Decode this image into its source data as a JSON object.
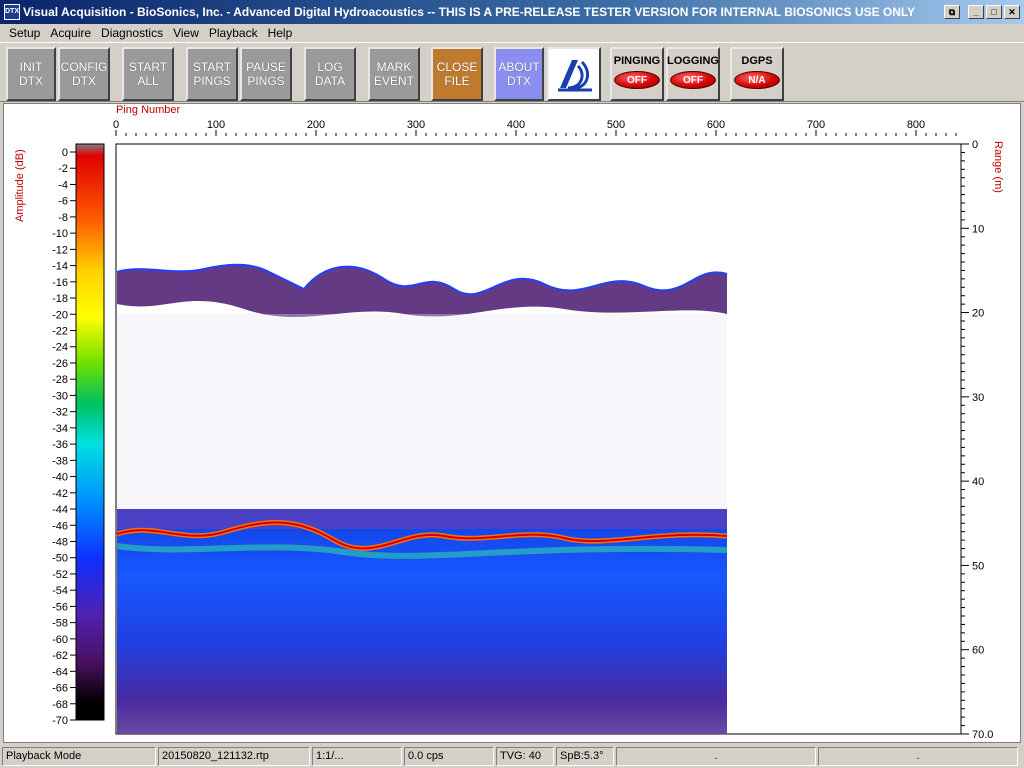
{
  "titlebar": {
    "icon_text": "DTX",
    "title": "Visual Acquisition  -  BioSonics, Inc.  -  Advanced Digital Hydroacoustics  -- THIS IS A PRE-RELEASE TESTER VERSION FOR INTERNAL BIOSONICS USE ONLY",
    "restore_glyph": "⧉",
    "minimize_glyph": "_",
    "maximize_glyph": "□",
    "close_glyph": "✕"
  },
  "menu": [
    "Setup",
    "Acquire",
    "Diagnostics",
    "View",
    "Playback",
    "Help"
  ],
  "toolbar": {
    "buttons": [
      {
        "line1": "INIT",
        "line2": "DTX"
      },
      {
        "line1": "CONFIG",
        "line2": "DTX"
      },
      {
        "line1": "START",
        "line2": "ALL"
      },
      {
        "line1": "START",
        "line2": "PINGS"
      },
      {
        "line1": "PAUSE",
        "line2": "PINGS"
      },
      {
        "line1": "LOG",
        "line2": "DATA"
      },
      {
        "line1": "MARK",
        "line2": "EVENT"
      },
      {
        "line1": "CLOSE",
        "line2": "FILE"
      },
      {
        "line1": "ABOUT",
        "line2": "DTX"
      }
    ],
    "logo_icon": "biosonics-logo-icon",
    "indicators": [
      {
        "label": "PINGING",
        "state": "OFF"
      },
      {
        "label": "LOGGING",
        "state": "OFF"
      },
      {
        "label": "DGPS",
        "state": "N/A"
      }
    ]
  },
  "plot": {
    "ping_axis_label": "Ping Number",
    "ping_ticks": [
      "0",
      "100",
      "200",
      "300",
      "400",
      "500",
      "600",
      "700",
      "800"
    ],
    "amplitude_label": "Amplitude (dB)",
    "amplitude_ticks": [
      "0",
      "-2",
      "-4",
      "-6",
      "-8",
      "-10",
      "-12",
      "-14",
      "-16",
      "-18",
      "-20",
      "-22",
      "-24",
      "-26",
      "-28",
      "-30",
      "-32",
      "-34",
      "-36",
      "-38",
      "-40",
      "-42",
      "-44",
      "-46",
      "-48",
      "-50",
      "-52",
      "-54",
      "-56",
      "-58",
      "-60",
      "-62",
      "-64",
      "-66",
      "-68",
      "-70"
    ],
    "range_label": "Range (m)",
    "range_ticks": [
      "0",
      "10",
      "20",
      "30",
      "40",
      "50",
      "60",
      "70.0"
    ],
    "accent_color": "#c00000"
  },
  "statusbar": {
    "mode": "Playback Mode",
    "file": "20150820_121132.rtp",
    "ratio": "1:1/...",
    "cps": "0.0 cps",
    "tvg": "TVG: 40",
    "spb": "SpB:5.3°",
    "cell7": ".",
    "cell8": "."
  }
}
